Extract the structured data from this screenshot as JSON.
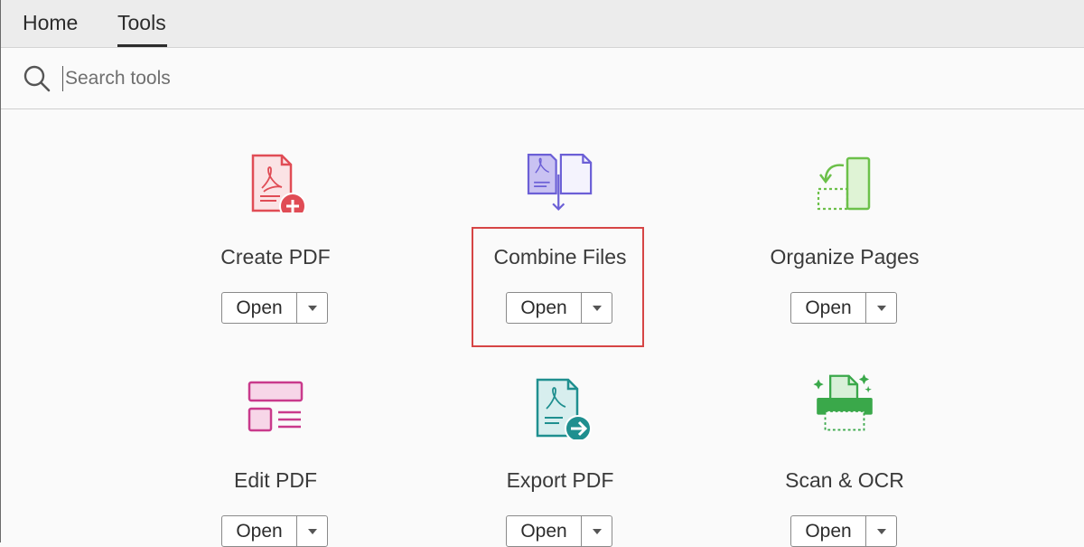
{
  "tabs": {
    "home": "Home",
    "tools": "Tools"
  },
  "search": {
    "placeholder": "Search tools"
  },
  "tools": [
    {
      "label": "Create PDF",
      "open_label": "Open",
      "icon": "create-pdf-icon",
      "color": "#e04c55"
    },
    {
      "label": "Combine Files",
      "open_label": "Open",
      "icon": "combine-files-icon",
      "color": "#6b5fd6"
    },
    {
      "label": "Organize Pages",
      "open_label": "Open",
      "icon": "organize-pages-icon",
      "color": "#6cc04a"
    },
    {
      "label": "Edit PDF",
      "open_label": "Open",
      "icon": "edit-pdf-icon",
      "color": "#c93a8c"
    },
    {
      "label": "Export PDF",
      "open_label": "Open",
      "icon": "export-pdf-icon",
      "color": "#1f8f8f"
    },
    {
      "label": "Scan & OCR",
      "open_label": "Open",
      "icon": "scan-ocr-icon",
      "color": "#3aa84a"
    }
  ],
  "highlight_color": "#d64545"
}
